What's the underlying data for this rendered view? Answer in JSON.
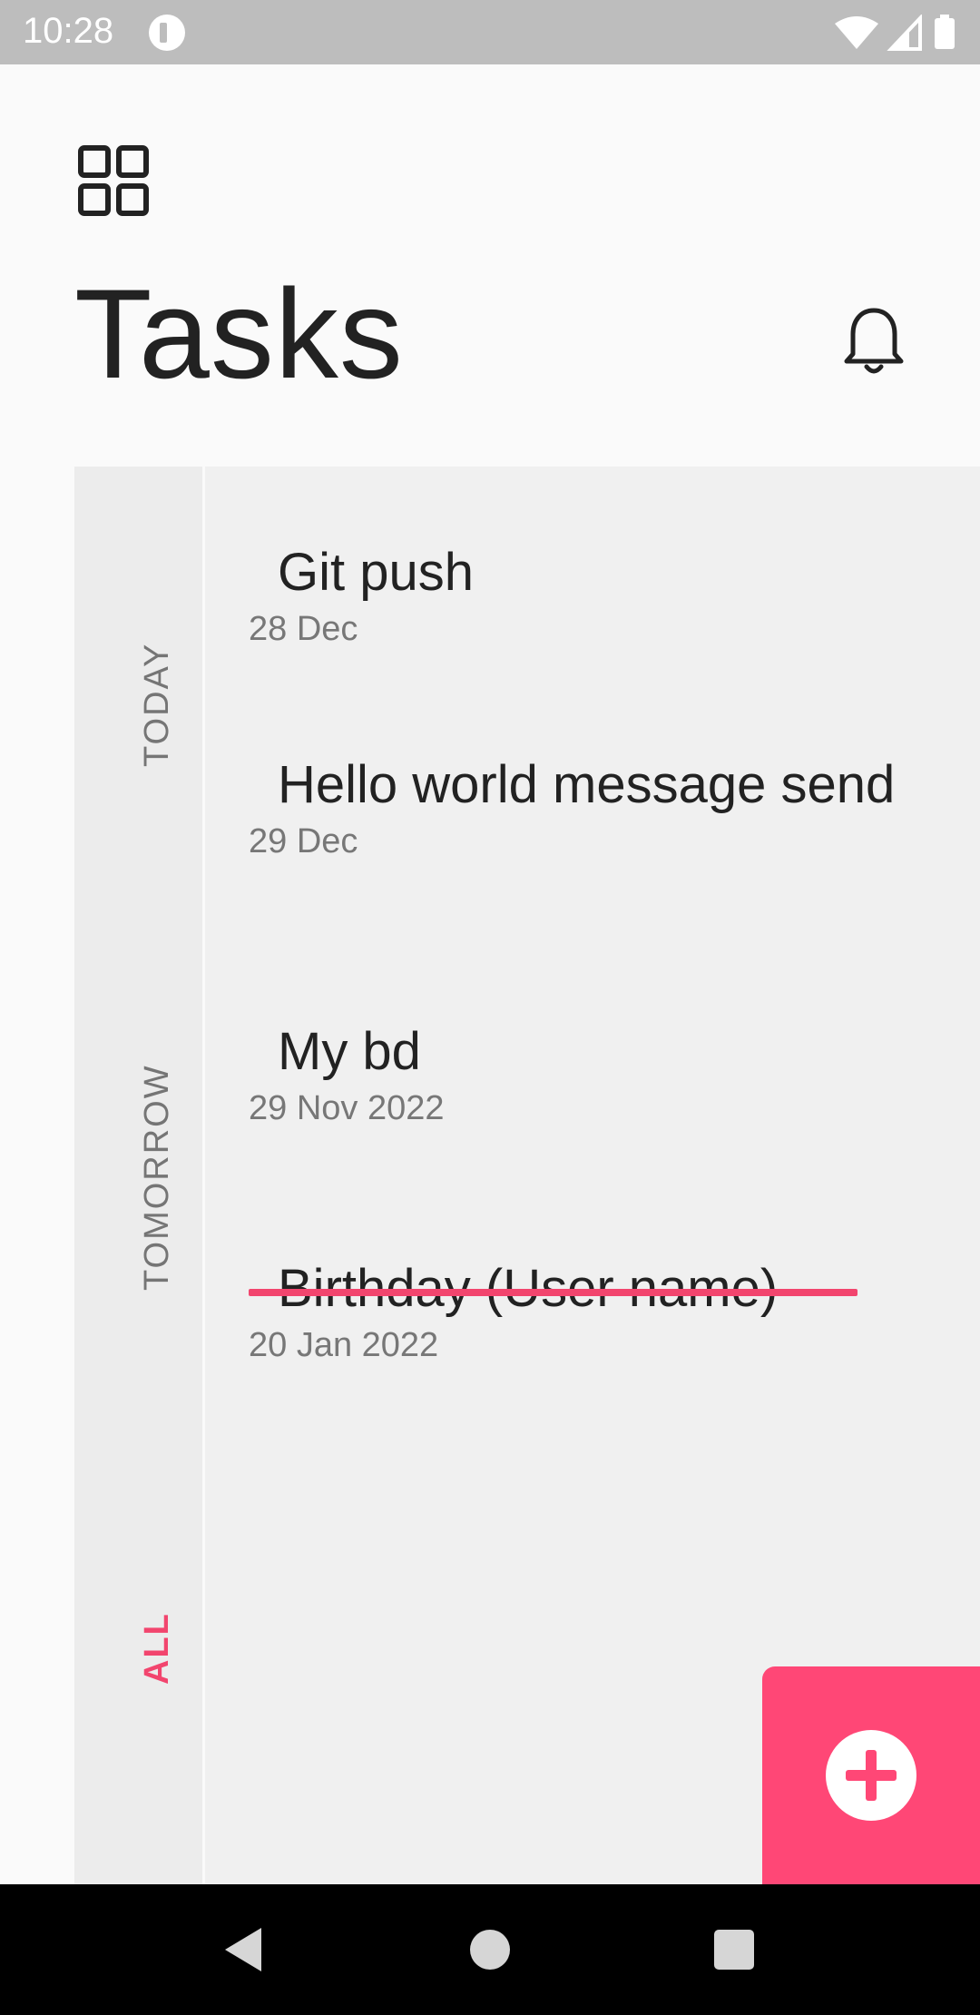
{
  "status_bar": {
    "time": "10:28",
    "icons": [
      "app-notification-icon",
      "wifi-icon",
      "cell-signal-icon",
      "battery-icon"
    ]
  },
  "header": {
    "title": "Tasks",
    "menu_icon": "grid-icon",
    "notification_icon": "bell-icon"
  },
  "filters": {
    "items": [
      {
        "label": "TODAY",
        "active": false
      },
      {
        "label": "TOMORROW",
        "active": false
      },
      {
        "label": "ALL",
        "active": true
      }
    ]
  },
  "tasks": [
    {
      "title": "Git push",
      "date": "28 Dec",
      "completed": false
    },
    {
      "title": "Hello world message send",
      "date": "29 Dec",
      "completed": false
    },
    {
      "title": "My bd",
      "date": "29 Nov 2022",
      "completed": false
    },
    {
      "title": "Birthday (User name)",
      "date": "20 Jan 2022",
      "completed": true
    }
  ],
  "fab": {
    "icon": "plus-icon"
  },
  "nav_bar": {
    "icons": [
      "back-icon",
      "home-icon",
      "recents-icon"
    ]
  },
  "colors": {
    "accent": "#ff4776",
    "accent_text": "#f2456e",
    "status_bar": "#bdbdbd",
    "panel": "#f0f0f0",
    "background": "#fafafa"
  }
}
